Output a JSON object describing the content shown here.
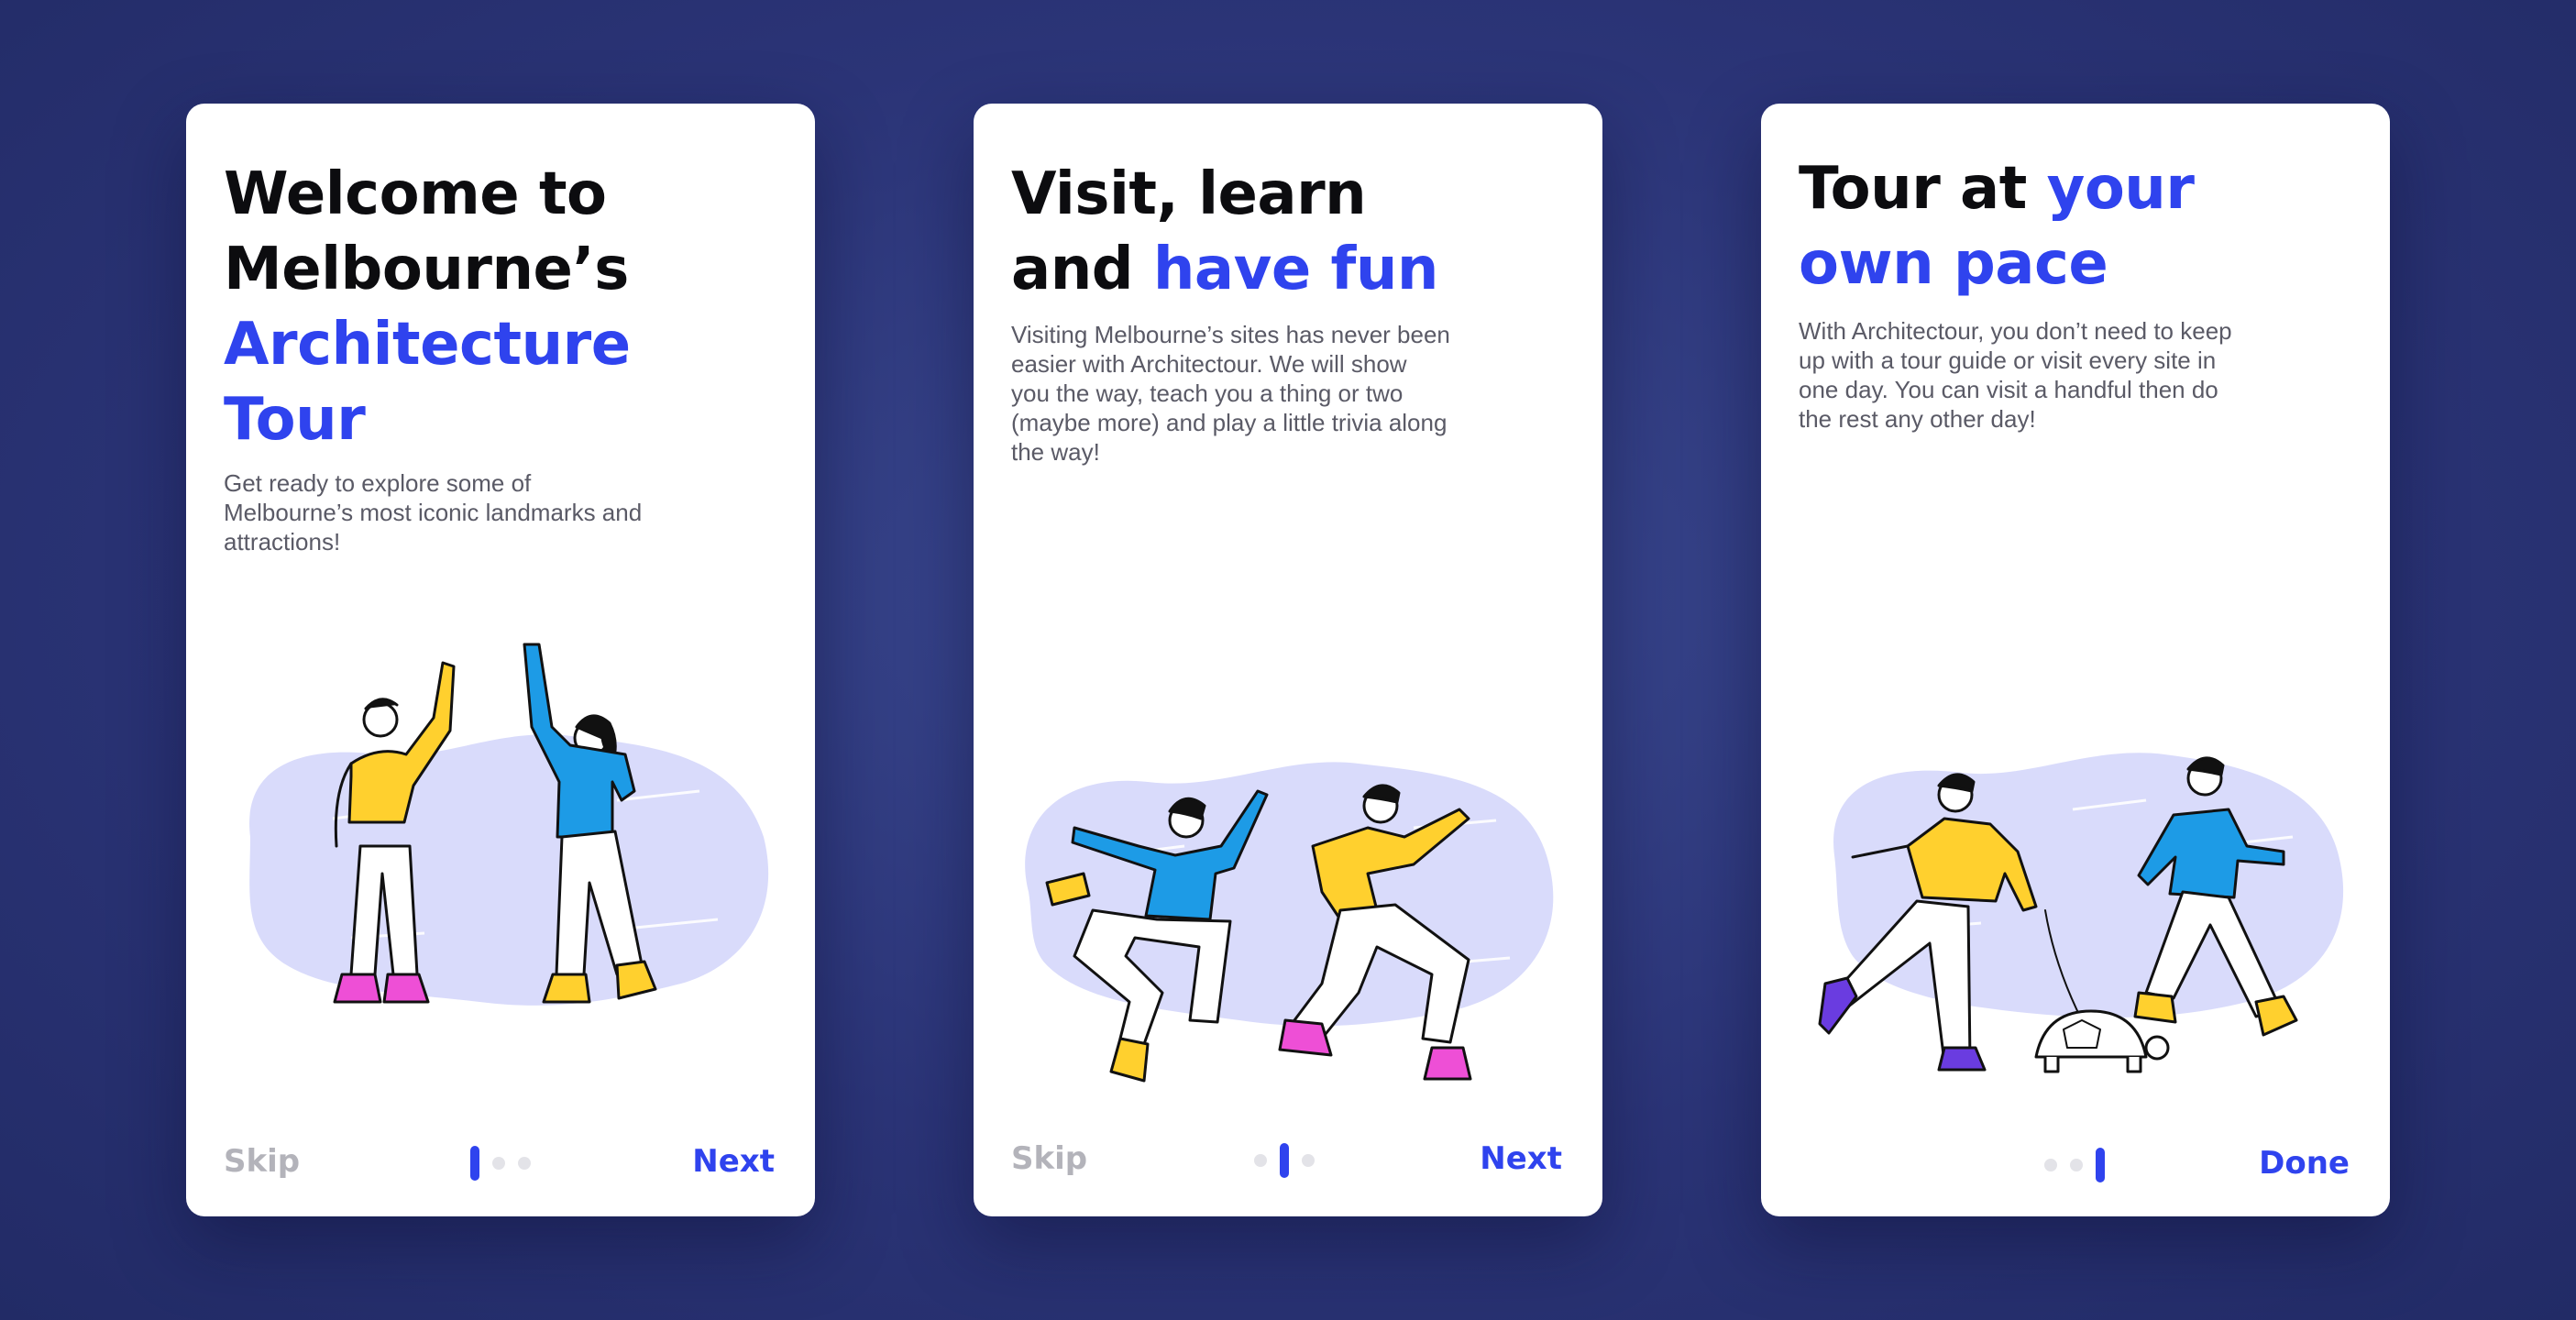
{
  "screens": [
    {
      "title_lines": [
        "Welcome to",
        "Melbourne’s"
      ],
      "title_highlight_lines": [
        "Architecture",
        "Tour"
      ],
      "body": "Get ready to explore some of Melbourne’s most iconic landmarks and attractions!",
      "skip_label": "Skip",
      "next_label": "Next",
      "page_index": 1,
      "page_count": 3
    },
    {
      "title_line1": "Visit, learn",
      "title_line2_plain": "and ",
      "title_line2_highlight": "have fun",
      "body": "Visiting Melbourne’s sites has never been easier with Architectour. We will show you the way, teach you a thing or two (maybe more) and play a little trivia along the way!",
      "skip_label": "Skip",
      "next_label": "Next",
      "page_index": 2,
      "page_count": 3
    },
    {
      "title_line1_plain": "Tour at ",
      "title_line1_highlight": "your",
      "title_line2_highlight": "own pace",
      "body": "With Architectour, you don’t need to keep up with a tour guide or visit every site in one day. You can visit a handful then do the rest any other day!",
      "done_label": "Done",
      "page_index": 3,
      "page_count": 3
    }
  ],
  "colors": {
    "accent": "#2f43ee",
    "title_text": "#0c0c0f",
    "body_text": "#5a5a66",
    "skip_text": "#b3b3ba",
    "background": "#2b3477",
    "blob": "#d9dbfb",
    "shirt_yellow": "#ffd02e",
    "shirt_blue": "#1d9be6",
    "shoe_pink": "#ee4fd6",
    "shoe_purple": "#6a3ce0"
  },
  "illustrations": [
    "people-high-five-illustration",
    "people-dancing-illustration",
    "people-walking-with-tortoise-illustration"
  ]
}
